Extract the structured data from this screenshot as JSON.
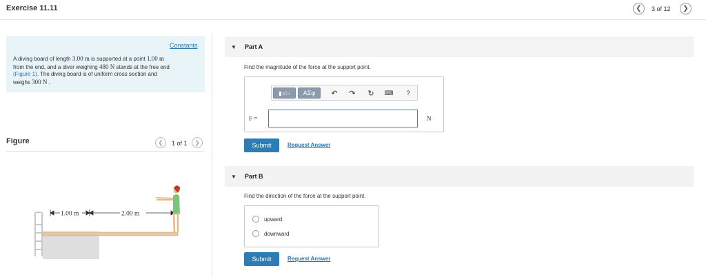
{
  "header": {
    "title": "Exercise 11.11",
    "counter": "3 of 12"
  },
  "problem": {
    "constants_label": "Constants",
    "line1_pre": "A diving board of length ",
    "length": "3.00 m",
    "line1_mid": " is supported at a point ",
    "support_dist": "1.00 m",
    "line2_pre": "from the end, and a diver weighing ",
    "diver_weight": "480 N",
    "line2_post": " stands at the free end",
    "figure_link": "(Figure 1)",
    "line3_post": ". The diving board is of uniform cross section and",
    "line4_pre": "weighs ",
    "board_weight": "300 N",
    "line4_post": " ."
  },
  "figure": {
    "label": "Figure",
    "counter": "1 of 1",
    "dim1": "1.00 m",
    "dim2": "2.00 m"
  },
  "partA": {
    "title": "Part A",
    "prompt": "Find the magnitude of the force at the support point.",
    "variable": "F =",
    "unit": "N",
    "input_value": "",
    "toolbar_greek": "ΑΣφ",
    "toolbar_help": "?",
    "submit": "Submit",
    "request": "Request Answer"
  },
  "partB": {
    "title": "Part B",
    "prompt": "Find the direction of the force at the support point.",
    "options": [
      "upward",
      "downward"
    ],
    "submit": "Submit",
    "request": "Request Answer"
  }
}
